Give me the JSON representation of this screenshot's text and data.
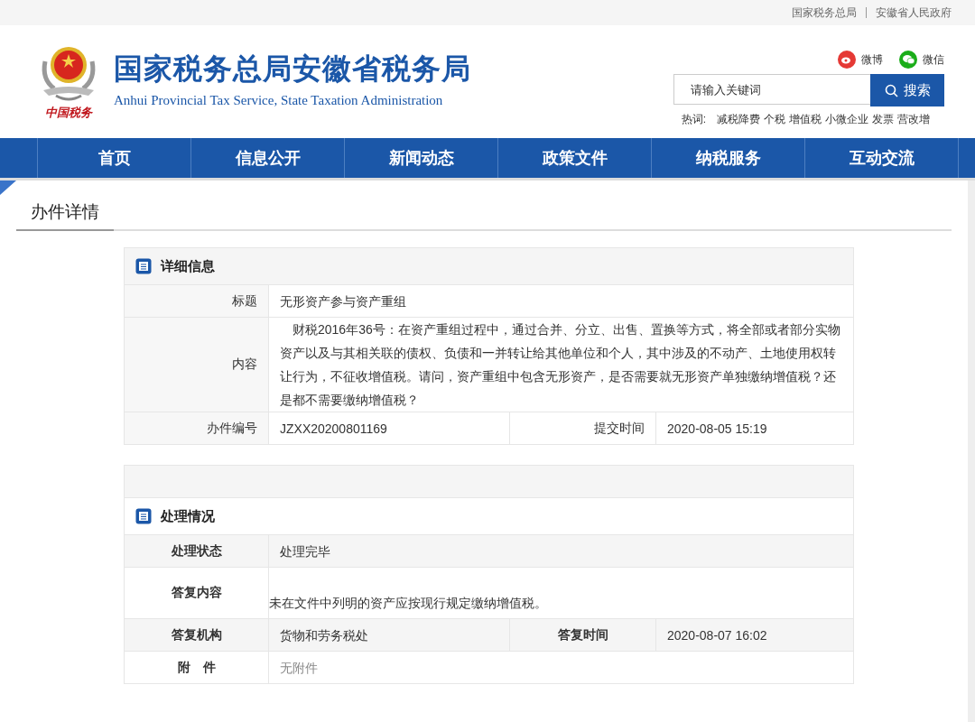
{
  "top_links": [
    "国家税务总局",
    "安徽省人民政府"
  ],
  "logo": {
    "title": "国家税务总局安徽省税务局",
    "subtitle": "Anhui Provincial Tax Service, State Taxation Administration",
    "emblem_caption": "中国税务"
  },
  "social": [
    {
      "kind": "weibo",
      "label": "微博",
      "color": "#e53935"
    },
    {
      "kind": "wechat",
      "label": "微信",
      "color": "#1aad19"
    }
  ],
  "search": {
    "placeholder": "请输入关键词",
    "button": "搜索"
  },
  "hot_words": {
    "label": "热词:",
    "items": [
      "减税降费",
      "个税",
      "增值税",
      "小微企业",
      "发票",
      "营改增"
    ]
  },
  "nav": [
    "首页",
    "信息公开",
    "新闻动态",
    "政策文件",
    "纳税服务",
    "互动交流"
  ],
  "page_heading": "办件详情",
  "detail": {
    "title": "详细信息",
    "rows": [
      {
        "pairs": [
          {
            "label": "标题",
            "value": "无形资产参与资产重组"
          }
        ]
      },
      {
        "pairs": [
          {
            "label": "内容",
            "value": "　财税2016年36号：在资产重组过程中，通过合并、分立、出售、置换等方式，将全部或者部分实物资产以及与其相关联的债权、负债和一并转让给其他单位和个人，其中涉及的不动产、土地使用权转让行为，不征收增值税。请问，资产重组中包含无形资产，是否需要就无形资产单独缴纳增值税？还是都不需要缴纳增值税？"
          }
        ]
      },
      {
        "pairs": [
          {
            "label": "办件编号",
            "value": "JZXX20200801169"
          },
          {
            "label": "提交时间",
            "value": "2020-08-05 15:19"
          }
        ]
      }
    ]
  },
  "processing": {
    "title": "处理情况",
    "rows": [
      {
        "pairs": [
          {
            "label": "处理状态",
            "value": "处理完毕"
          }
        ]
      },
      {
        "pairs": [
          {
            "label": "答复内容",
            "value": "未在文件中列明的资产应按现行规定缴纳增值税。"
          }
        ],
        "tall": true
      },
      {
        "pairs": [
          {
            "label": "答复机构",
            "value": "货物和劳务税处"
          },
          {
            "label": "答复时间",
            "value": "2020-08-07 16:02"
          }
        ]
      },
      {
        "pairs": [
          {
            "label": "附　件",
            "value": "无附件"
          }
        ],
        "muted": true
      }
    ]
  }
}
